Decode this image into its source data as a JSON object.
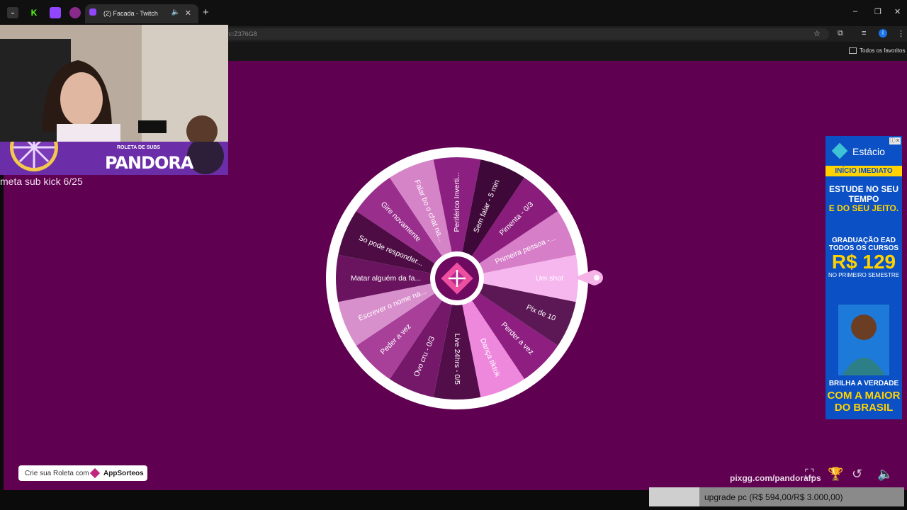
{
  "browser": {
    "tab_title": "(2) Facada - Twitch",
    "url": "h=Z376G8",
    "bookmarks_label": "Todos os favoritos",
    "profile_initial": "I"
  },
  "overlay": {
    "banner_subtitle": "ROLETA DE SUBS",
    "banner_title": "PANDORA",
    "meta_text": "meta sub kick 6/25"
  },
  "wheel": {
    "segments": [
      {
        "label": "Um shot",
        "color": "#f6b6ee"
      },
      {
        "label": "Pix de 10",
        "color": "#5c1854"
      },
      {
        "label": "Perder a vez",
        "color": "#8e1e80"
      },
      {
        "label": "Dança tiktok",
        "color": "#ee88dc"
      },
      {
        "label": "Live 24hrs - 0/5",
        "color": "#520e49"
      },
      {
        "label": "Ovo cru - 0/3",
        "color": "#76186a"
      },
      {
        "label": "Peder a vez",
        "color": "#a8409a"
      },
      {
        "label": "Escrever o nome na...",
        "color": "#d890cc"
      },
      {
        "label": "Matar alguém da fa...",
        "color": "#6a1460"
      },
      {
        "label": "So pode responder...",
        "color": "#4e0c44"
      },
      {
        "label": "Gire novamente",
        "color": "#9a2e8c"
      },
      {
        "label": "Falar bo o chat na...",
        "color": "#d684c8"
      },
      {
        "label": "Periférico Inverti...",
        "color": "#8c2080"
      },
      {
        "label": "Sem falar - 5 min",
        "color": "#3e0838"
      },
      {
        "label": "Pimenta - 0/3",
        "color": "#8a1c7c"
      },
      {
        "label": "Primeira pessoa -...",
        "color": "#d67ec8"
      }
    ]
  },
  "promo": {
    "text": "Crie sua Roleta com",
    "brand": "AppSorteos"
  },
  "footer": {
    "pixgg": "pixgg.com/pandorafps",
    "goal_text": "upgrade pc (R$ 594,00/R$ 3.000,00)",
    "goal_progress": 0.198
  },
  "ad": {
    "brand": "Estácio",
    "band": "INÍCIO IMEDIATO",
    "line1": "ESTUDE NO SEU TEMPO",
    "line2": "E DO SEU JEITO.",
    "small": "GRADUAÇÃO EAD TODOS OS CURSOS",
    "price": "R$ 129",
    "note": "NO PRIMEIRO SEMESTRE",
    "tag1": "BRILHA A VERDADE",
    "tag2": "COM A MAIOR DO BRASIL"
  },
  "icons": [
    "tab-list-icon",
    "kick-icon",
    "twitch-icon",
    "speaker-icon",
    "close-icon",
    "plus-icon",
    "minimize-icon",
    "maximize-icon",
    "star-icon",
    "extensions-icon",
    "media-icon",
    "menu-icon",
    "folder-icon",
    "trophy-icon",
    "undo-icon",
    "volume-icon",
    "fullscreen-icon"
  ]
}
